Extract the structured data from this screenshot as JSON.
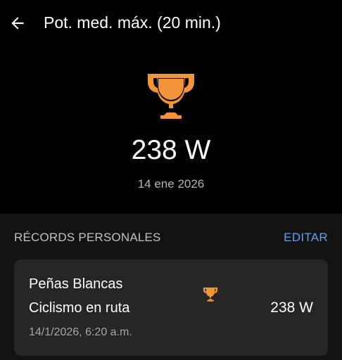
{
  "header": {
    "back_icon": "arrow-left-icon",
    "title": "Pot. med. máx. (20 min.)"
  },
  "hero": {
    "icon": "trophy-icon",
    "value": "238 W",
    "date": "14 ene 2026"
  },
  "records": {
    "section_title": "RÉCORDS PERSONALES",
    "edit_label": "EDITAR",
    "items": [
      {
        "location": "Peñas Blancas",
        "activity": "Ciclismo en ruta",
        "datetime": "14/1/2026, 6:20 a.m.",
        "icon": "trophy-icon",
        "value": "238 W"
      }
    ]
  },
  "colors": {
    "background": "#000000",
    "panel": "#121212",
    "card": "#262626",
    "accent_trophy": "#f2953a",
    "link": "#5ba3f0",
    "secondary_text": "#b3b3b3"
  }
}
